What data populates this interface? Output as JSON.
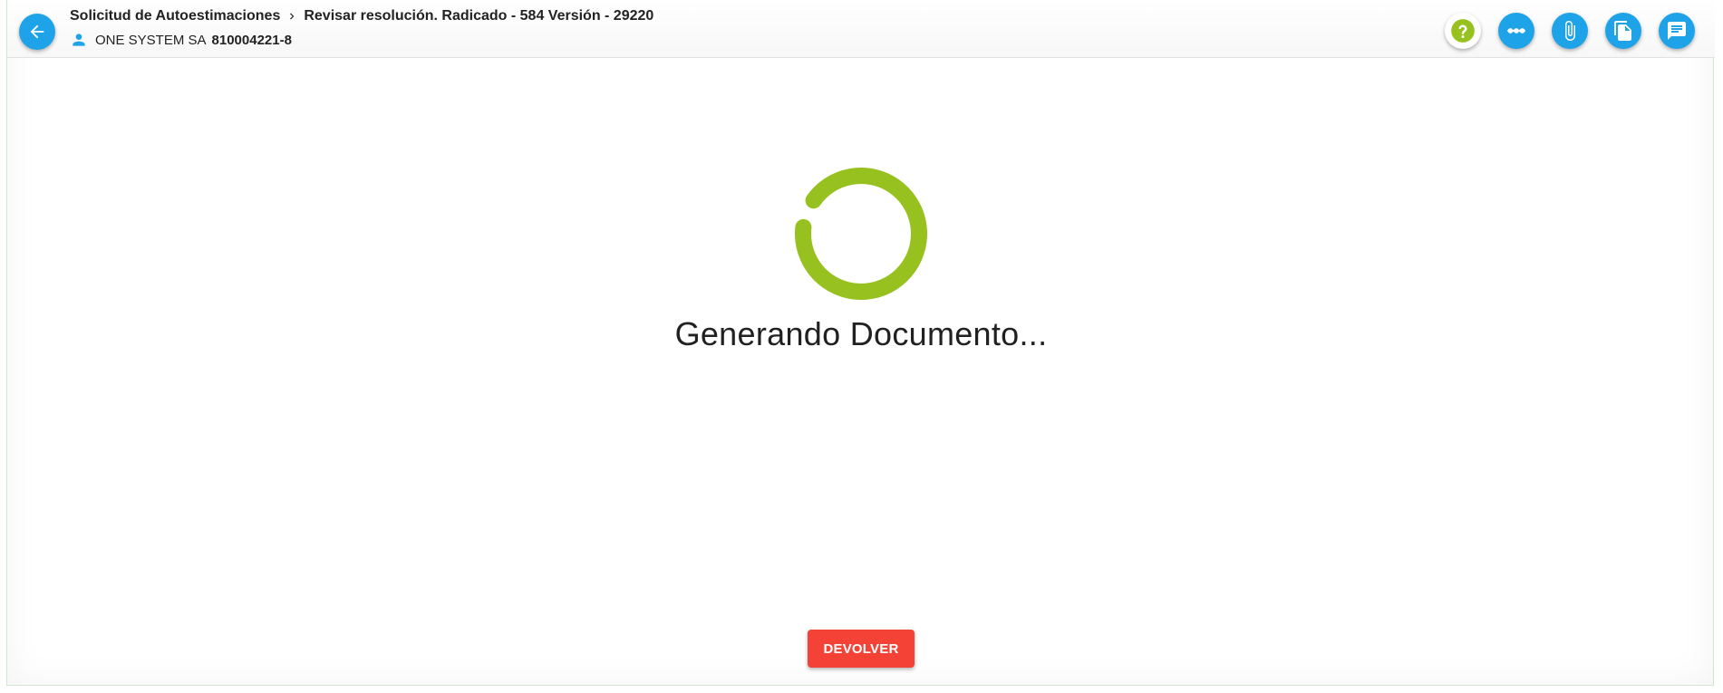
{
  "header": {
    "breadcrumb": {
      "parent": "Solicitud de Autoestimaciones",
      "current": "Revisar resolución. Radicado - 584 Versión - 29220"
    },
    "company": {
      "name": "ONE SYSTEM SA",
      "nit": "810004221-8"
    },
    "actions": [
      {
        "icon": "help-icon",
        "color": "#97c11f"
      },
      {
        "icon": "timeline-icon",
        "color": "#ffffff"
      },
      {
        "icon": "attachment-icon",
        "color": "#ffffff"
      },
      {
        "icon": "documents-icon",
        "color": "#ffffff"
      },
      {
        "icon": "comment-icon",
        "color": "#ffffff"
      }
    ]
  },
  "main": {
    "loading_text": "Generando Documento...",
    "spinner_color": "#97c11f"
  },
  "footer": {
    "return_label": "DEVOLVER"
  },
  "colors": {
    "primary": "#1ea3e8",
    "accent": "#97c11f",
    "danger": "#f44336"
  }
}
